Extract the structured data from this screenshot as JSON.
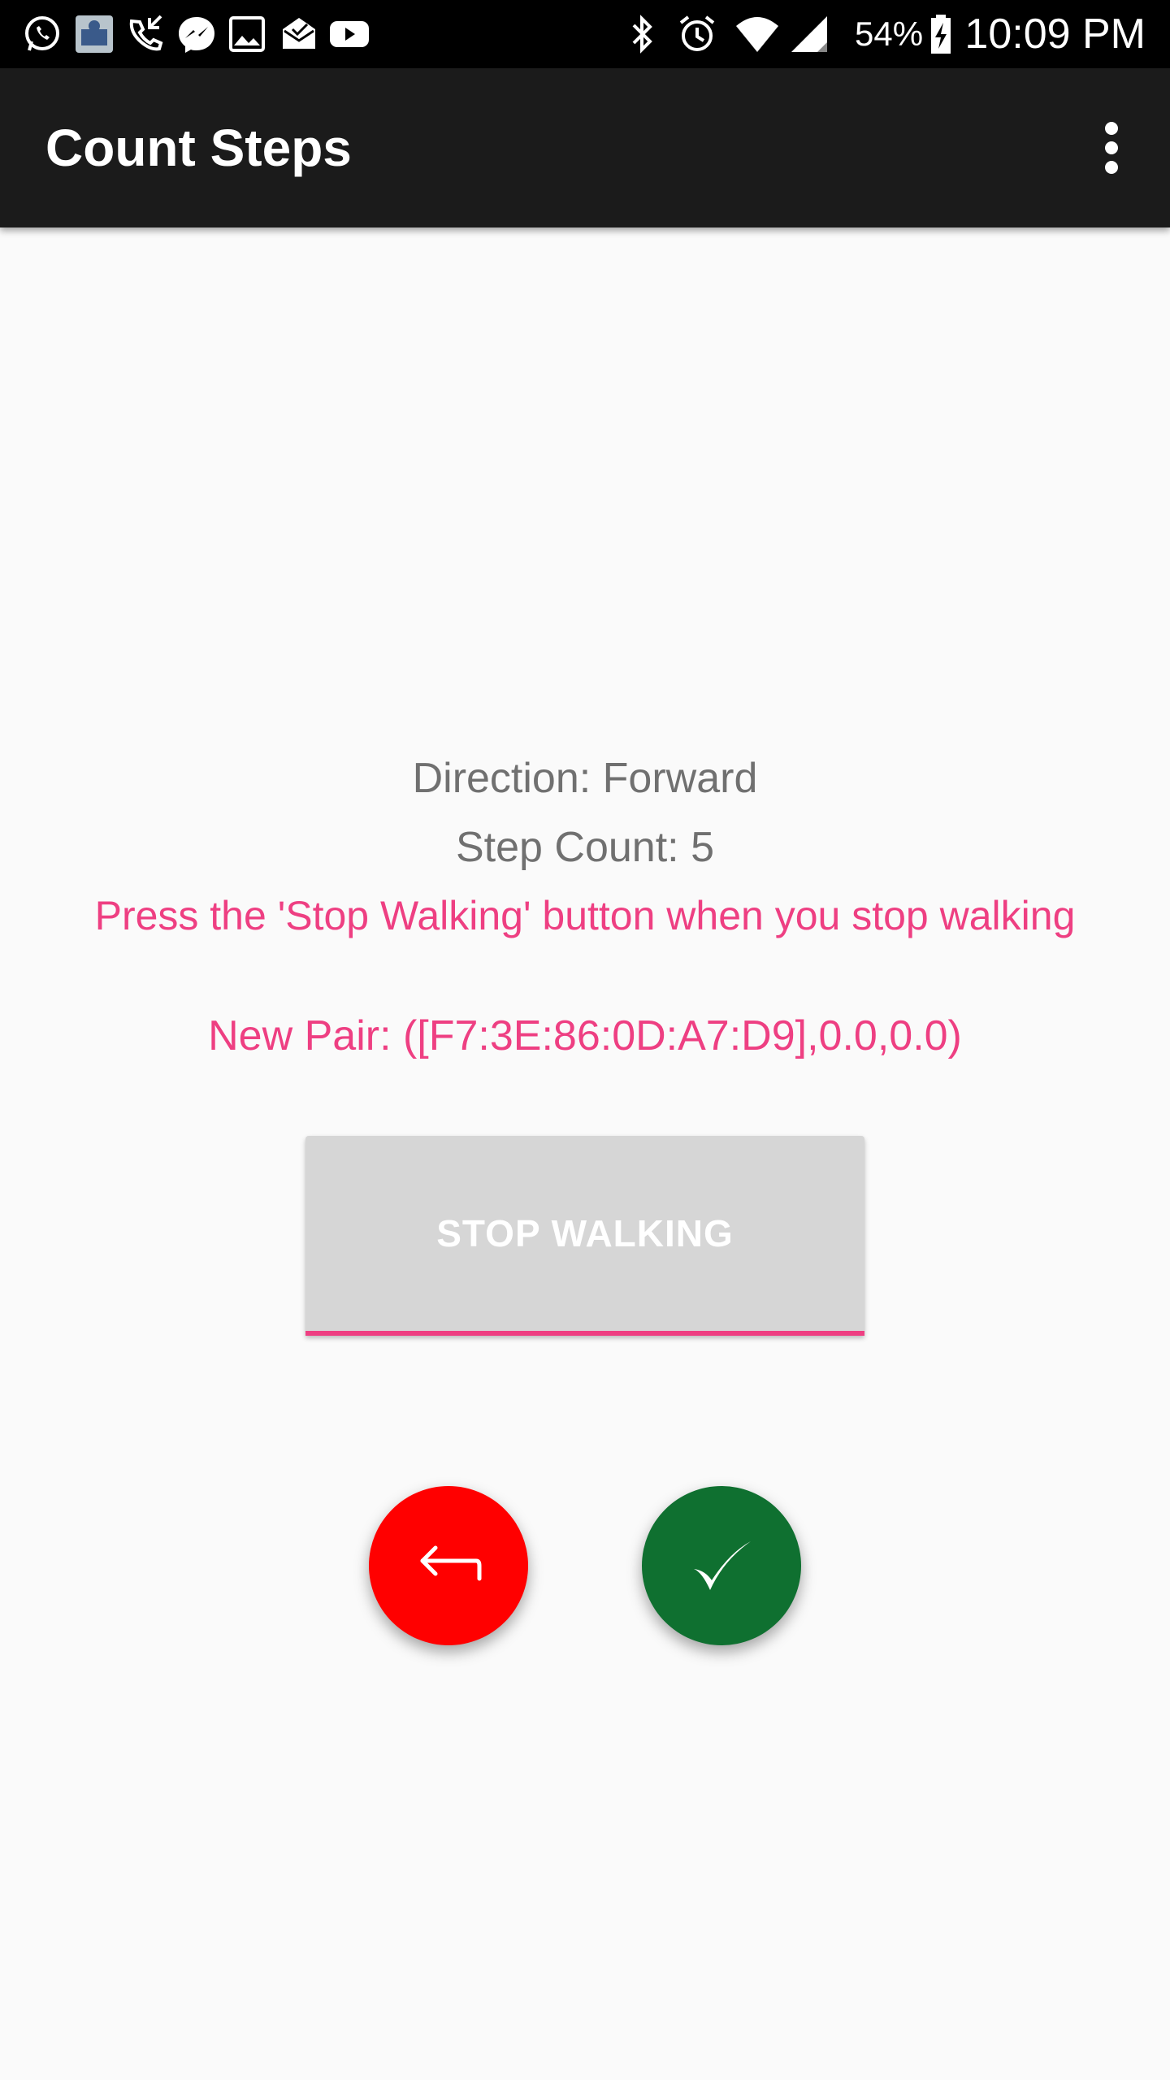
{
  "status_bar": {
    "battery_percent": "54%",
    "time": "10:09 PM",
    "icons": [
      "whatsapp-icon",
      "app-notification-icon",
      "missed-call-icon",
      "messenger-icon",
      "gallery-icon",
      "email-icon",
      "youtube-icon",
      "bluetooth-icon",
      "alarm-icon",
      "wifi-icon",
      "signal-icon",
      "battery-charging-icon"
    ]
  },
  "app_bar": {
    "title": "Count Steps",
    "menu_icon": "more-vert-icon"
  },
  "content": {
    "direction": "Direction: Forward",
    "step_count": "Step Count: 5",
    "instruction": "Press the 'Stop Walking' button when you stop walking",
    "new_pair": "New Pair: ([F7:3E:86:0D:A7:D9],0.0,0.0)",
    "stop_button_label": "STOP WALKING"
  },
  "actions": {
    "undo_icon": "undo-icon",
    "confirm_icon": "check-icon"
  },
  "colors": {
    "accent": "#ee3f82",
    "undo": "#ff0000",
    "confirm": "#0f7030",
    "app_bar": "#1b1b1b"
  }
}
